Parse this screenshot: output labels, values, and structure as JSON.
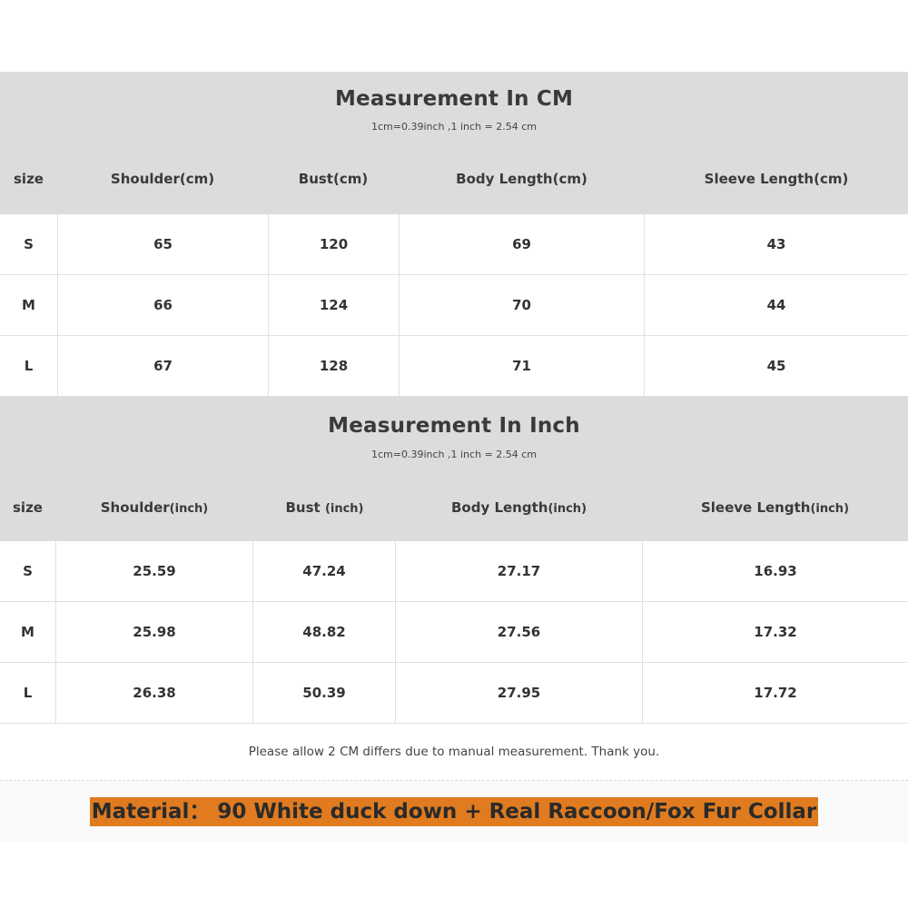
{
  "cm_table": {
    "title": "Measurement In CM",
    "subtitle": "1cm=0.39inch ,1 inch = 2.54 cm",
    "headers": [
      "size",
      "Shoulder(cm)",
      "Bust(cm)",
      "Body Length(cm)",
      "Sleeve Length(cm)"
    ],
    "rows": [
      [
        "S",
        "65",
        "120",
        "69",
        "43"
      ],
      [
        "M",
        "66",
        "124",
        "70",
        "44"
      ],
      [
        "L",
        "67",
        "128",
        "71",
        "45"
      ]
    ]
  },
  "inch_table": {
    "title": "Measurement In Inch",
    "subtitle": "1cm=0.39inch ,1 inch = 2.54 cm",
    "headers": [
      {
        "label": "size",
        "unit": ""
      },
      {
        "label": "Shoulder",
        "unit": "(inch)"
      },
      {
        "label": "Bust ",
        "unit": "(inch)"
      },
      {
        "label": "Body Length",
        "unit": "(inch)"
      },
      {
        "label": "Sleeve Length",
        "unit": "(inch)"
      }
    ],
    "rows": [
      [
        "S",
        "25.59",
        "47.24",
        "27.17",
        "16.93"
      ],
      [
        "M",
        "25.98",
        "48.82",
        "27.56",
        "17.32"
      ],
      [
        "L",
        "26.38",
        "50.39",
        "27.95",
        "17.72"
      ]
    ]
  },
  "note": "Please allow 2 CM differs due to manual measurement. Thank you.",
  "material": "Material： 90 White duck down + Real Raccoon/Fox Fur Collar",
  "colors": {
    "header_bg": "#dcdcdc",
    "material_highlight": "#e07b1f"
  }
}
